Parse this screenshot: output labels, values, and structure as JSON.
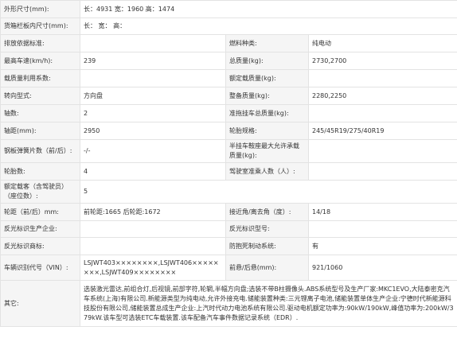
{
  "rows": [
    {
      "l1": "外形尺寸(mm):",
      "v1": "长：4931 宽：1960 高：1474"
    },
    {
      "l1": "货箱栏板内尺寸(mm):",
      "v1": "长：  宽：  高："
    },
    {
      "l1": "排放依据标准:",
      "v1": "",
      "l2": "燃料种类:",
      "v2": "纯电动"
    },
    {
      "l1": "最高车速(km/h):",
      "v1": "239",
      "l2": "总质量(kg):",
      "v2": "2730,2700"
    },
    {
      "l1": "载质量利用系数:",
      "v1": "",
      "l2": "额定载质量(kg):",
      "v2": ""
    },
    {
      "l1": "转向型式:",
      "v1": "方向盘",
      "l2": "整备质量(kg):",
      "v2": "2280,2250"
    },
    {
      "l1": "轴数:",
      "v1": "2",
      "l2": "准拖挂车总质量(kg):",
      "v2": ""
    },
    {
      "l1": "轴距(mm):",
      "v1": "2950",
      "l2": "轮胎规格:",
      "v2": "245/45R19/275/40R19"
    },
    {
      "l1": "钢板弹簧片数（前/后）:",
      "v1": "-/-",
      "l2": "半挂车鞍座最大允许承载质量(kg):",
      "v2": ""
    },
    {
      "l1": "轮胎数:",
      "v1": "4",
      "l2": "驾驶室准乘人数（人）:",
      "v2": ""
    },
    {
      "l1": "额定载客（含驾驶员）（座位数）:",
      "v1": "5"
    },
    {
      "l1": "轮距（前/后）mm:",
      "v1": "前轮距:1665 后轮距:1672",
      "l2": "接近角/离去角（度）:",
      "v2": "14/18"
    },
    {
      "l1": "反光标识生产企业:",
      "v1": "",
      "l2": "反光标识型号:",
      "v2": ""
    },
    {
      "l1": "反光标识商标:",
      "v1": "",
      "l2": "防抱死制动系统:",
      "v2": "有"
    },
    {
      "l1": "车辆识别代号（VIN）:",
      "v1": "LSJWT403××××××××,LSJWT406××××××××,LSJWT409××××××××",
      "l2": "前悬/后悬(mm):",
      "v2": "921/1060"
    },
    {
      "l1": "其它:",
      "v1": "选装激光雷达,前组合灯,后视镜,前部字符,轮辋,半幅方向盘;选装不带B柱摄像头.ABS系统型号及生产厂家:MKC1EVO,大陆泰密克汽车系统(上海)有限公司.新能源类型为纯电动,允许外接充电.储能装置种类:三元锂离子电池,储能装置单体生产企业:宁德时代新能源科技股份有限公司,储能装置总成生产企业:上汽时代动力电池系统有限公司.驱动电机额定功率为:90kW/190kW,峰值功率为:200kW/379kW.该车型可选装ETC车载装置.该车配备汽车事件数据记录系统（EDR）."
    }
  ]
}
